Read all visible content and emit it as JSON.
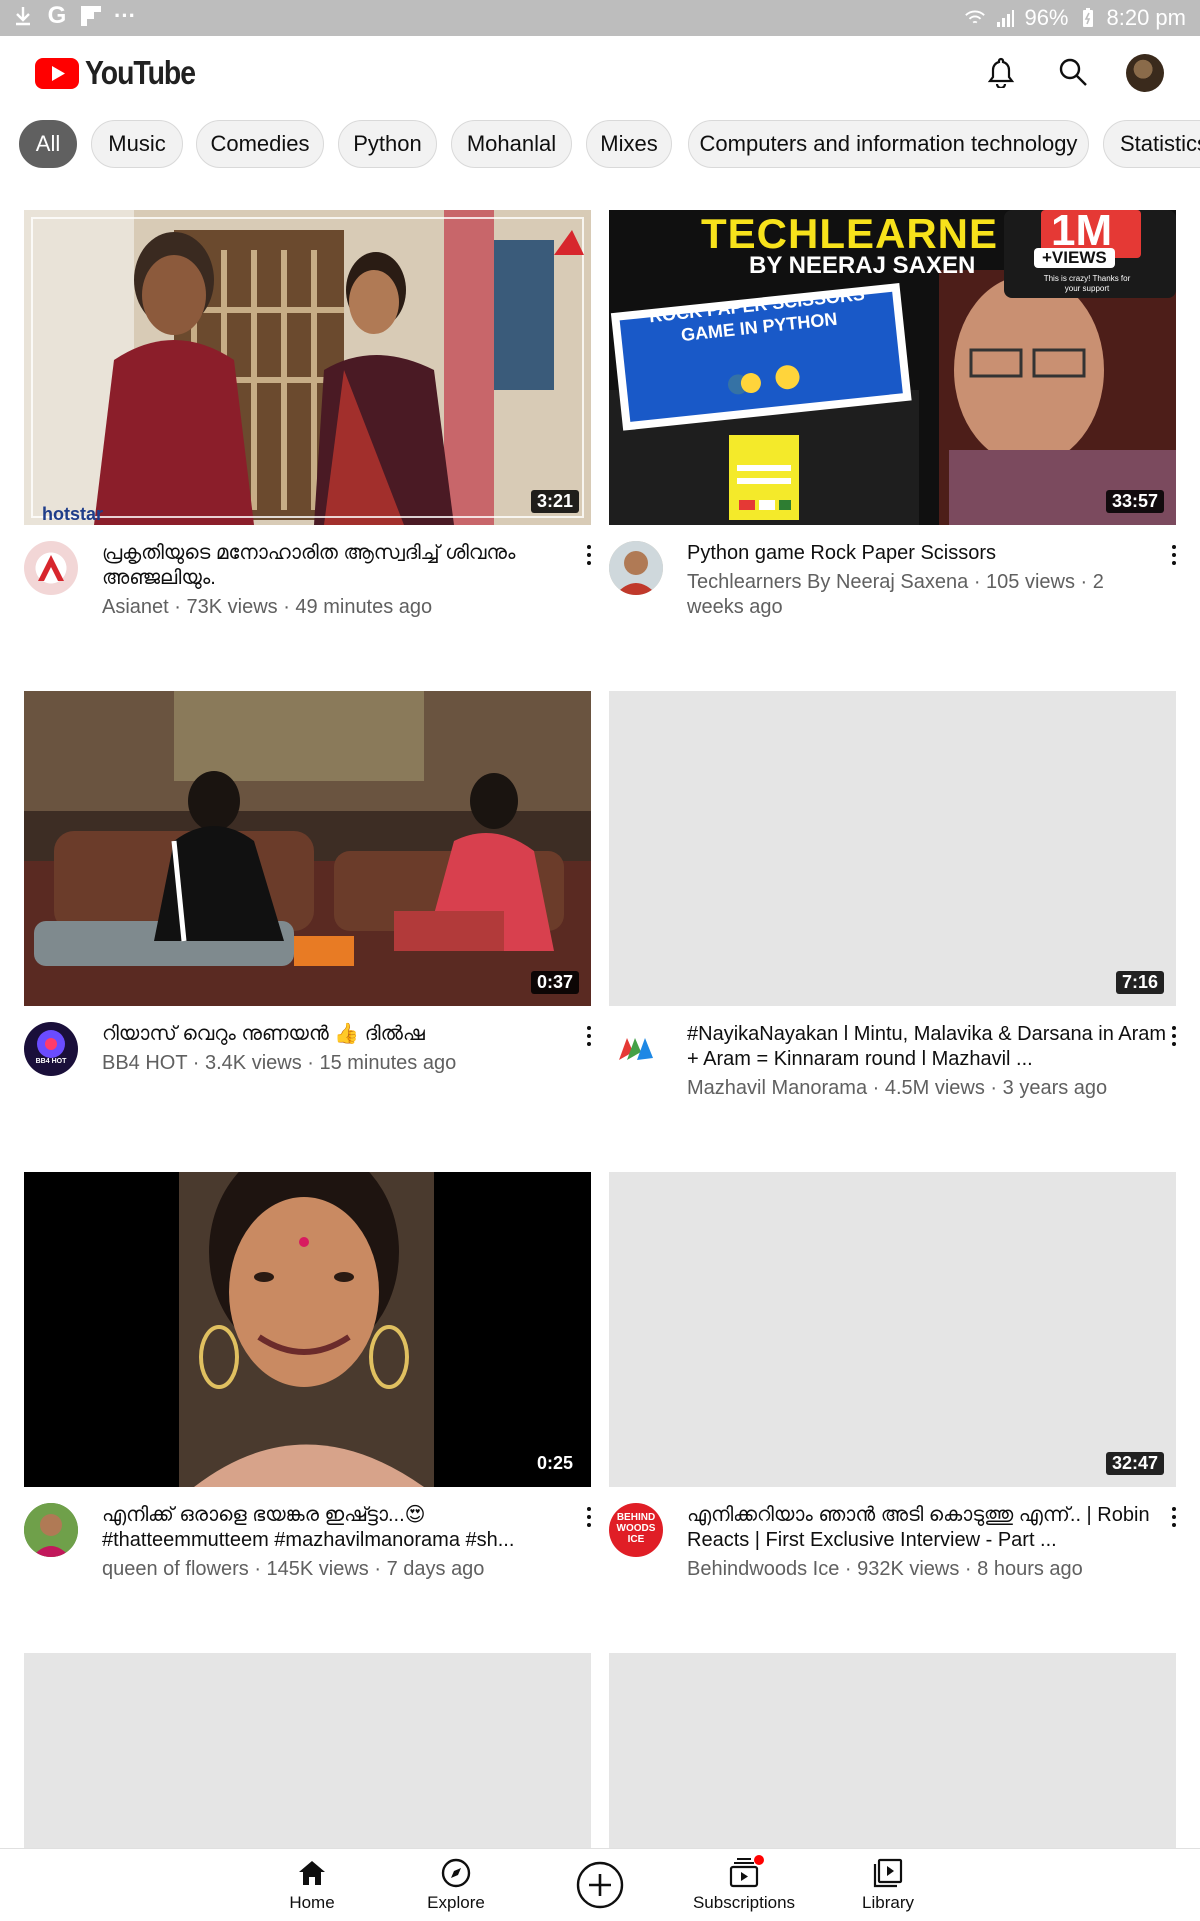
{
  "status_bar": {
    "battery": "96%",
    "time": "8:20 pm"
  },
  "header": {
    "app_name": "YouTube"
  },
  "chips": [
    "All",
    "Music",
    "Comedies",
    "Python",
    "Mohanlal",
    "Mixes",
    "Computers and information technology",
    "Statistics"
  ],
  "videos": [
    {
      "title": "പ്രകൃതിയുടെ മനോഹാരിത ആസ്വദിച്ച് ശിവനും അഞ്ജലിയും.",
      "meta": "Asianet · 73K views · 49 minutes ago",
      "duration": "3:21",
      "thumb_watermark": "hotstar"
    },
    {
      "title": "Python game Rock Paper Scissors",
      "meta": "Techlearners By Neeraj Saxena · 105 views · 2 weeks ago",
      "duration": "33:57",
      "thumb_text": {
        "headline": "TECHLEARNE",
        "subline": "BY NEERAJ SAXEN",
        "badge_big": "1M",
        "badge_small": "+VIEWS",
        "badge_note": "This is crazy! Thanks for your support",
        "card": "ROCK PAPER SCISSORS GAME IN PYTHON"
      }
    },
    {
      "title": "റിയാസ് വെറും നുണയൻ 👍 ദിൽഷ",
      "meta": "BB4 HOT · 3.4K views · 15 minutes ago",
      "duration": "0:37",
      "channel_badge": "BB4 HOT"
    },
    {
      "title": "#NayikaNayakan l Mintu, Malavika & Darsana in Aram + Aram = Kinnaram round l Mazhavil ...",
      "meta": "Mazhavil Manorama · 4.5M views · 3 years ago",
      "duration": "7:16"
    },
    {
      "title": "എനിക്ക് ഒരാളെ ഭയങ്കര ഇഷ്ട്ടാ...😍 #thatteemmutteem #mazhavilmanorama #sh...",
      "meta": "queen of flowers · 145K views · 7 days ago",
      "duration": "0:25"
    },
    {
      "title": "എനിക്കറിയാം ഞാൻ അടി കൊടുത്തു എന്ന്.. | Robin Reacts | First Exclusive Interview - Part ...",
      "meta": "Behindwoods Ice · 932K views · 8 hours ago",
      "duration": "32:47",
      "channel_badge": "BEHIND WOODS ICE"
    }
  ],
  "bottom_nav": [
    {
      "label": "Home",
      "icon": "home-icon"
    },
    {
      "label": "Explore",
      "icon": "compass-icon"
    },
    {
      "label": "",
      "icon": "create-plus-icon"
    },
    {
      "label": "Subscriptions",
      "icon": "subscriptions-icon"
    },
    {
      "label": "Library",
      "icon": "library-icon"
    }
  ],
  "colors": {
    "brand_red": "#ff0000",
    "chip_active": "#606060",
    "placeholder": "#e5e5e5"
  }
}
